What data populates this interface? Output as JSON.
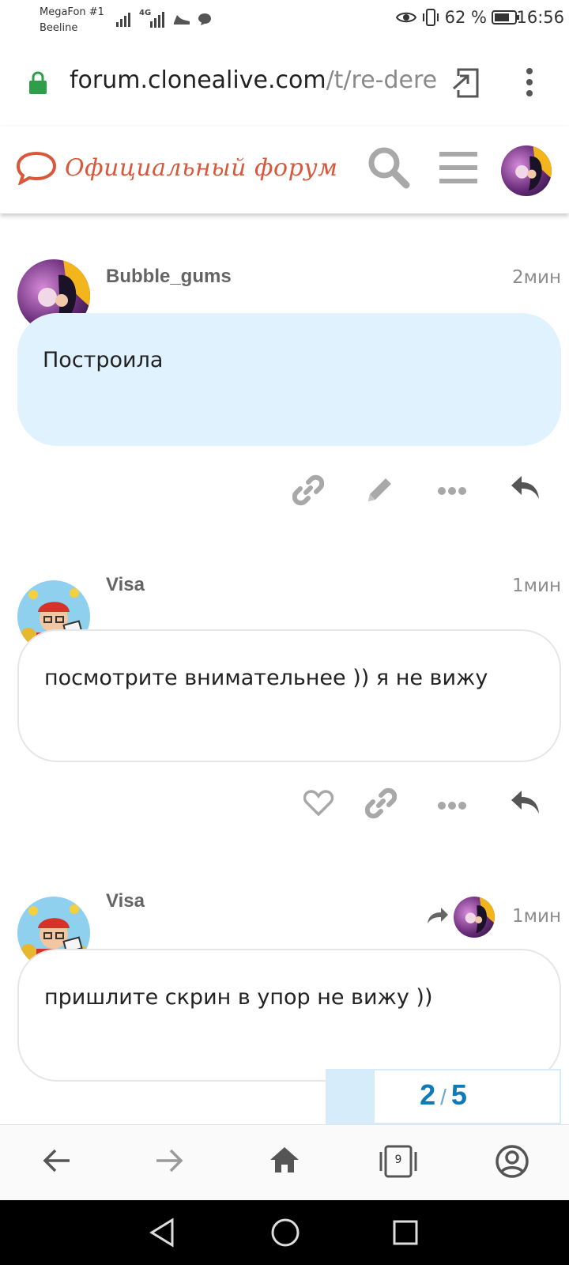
{
  "status_bar": {
    "carrier_1": "MegaFon #1",
    "carrier_2": "Beeline",
    "network_type": "4G",
    "battery": "62 %",
    "time": "16:56"
  },
  "browser": {
    "url_domain": "forum.clonealive.com",
    "url_path": "/t/re-derevi",
    "tab_count": "9"
  },
  "forum": {
    "title": "Официальный форум"
  },
  "posts": [
    {
      "username": "Bubble_gums",
      "time": "2мин",
      "text": "Построила",
      "bubble": "blue"
    },
    {
      "username": "Visa",
      "time": "1мин",
      "text": "посмотрите внимательнее )) я не вижу",
      "bubble": "white"
    },
    {
      "username": "Visa",
      "time": "1мин",
      "text": "пришлите скрин в упор не вижу ))",
      "bubble": "white"
    }
  ],
  "progress": {
    "current": "2",
    "separator": "/",
    "total": "5"
  },
  "colors": {
    "accent": "#0e7ab8",
    "logo": "#d9573a",
    "bubble_highlight": "#dff2fd",
    "secure_lock": "#2e9e48"
  },
  "icons": [
    "lock-icon",
    "share-to-app-icon",
    "more-vert-icon",
    "search-icon",
    "hamburger-icon",
    "link-icon",
    "edit-icon",
    "more-horiz-icon",
    "reply-icon",
    "heart-icon",
    "back-arrow-icon",
    "forward-arrow-icon",
    "home-icon",
    "tabs-icon",
    "account-icon"
  ]
}
